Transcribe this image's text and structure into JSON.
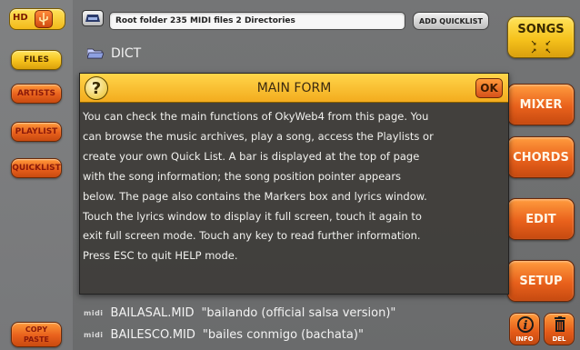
{
  "left_sidebar": {
    "hd_label": "HD",
    "files_label": "FILES",
    "artists_label": "ARTISTS",
    "playlist_label": "PLAYLIST",
    "quicklist_label": "QUICKLIST",
    "copy_paste_label_1": "COPY",
    "copy_paste_label_2": "PASTE"
  },
  "path_bar": {
    "path_text": "Root folder 235 MIDI files 2 Directories",
    "add_quicklist_label": "ADD QUICKLIST"
  },
  "folder_row": {
    "name": "DICT"
  },
  "right_sidebar": {
    "songs_label": "SONGS",
    "mixer_label": "MIXER",
    "chords_label": "CHORDS",
    "edit_label": "EDIT",
    "setup_label": "SETUP",
    "info_label": "INFO",
    "del_label": "DEL"
  },
  "help_dialog": {
    "title": "MAIN FORM",
    "ok_label": "OK",
    "lines": [
      "You can check the main functions of OkyWeb4 from this page. You",
      "can browse the music archives, play a song, access the Playlists or",
      "create your own Quick List. A bar is displayed at the top of page",
      "with the song information; the song position pointer appears",
      "below. The page also contains the Markers box and lyrics window.",
      "Touch the lyrics window to display it full screen, touch it again to",
      "exit full screen mode. Touch any key to read further information.",
      "Press ESC to quit HELP mode."
    ]
  },
  "file_list": {
    "tag": "midi",
    "rows": [
      {
        "file": "BAILASAL.MID",
        "title": "\"bailando (official salsa version)\""
      },
      {
        "file": "BAILESCO.MID",
        "title": "\"bailes conmigo (bachata)\""
      }
    ]
  }
}
